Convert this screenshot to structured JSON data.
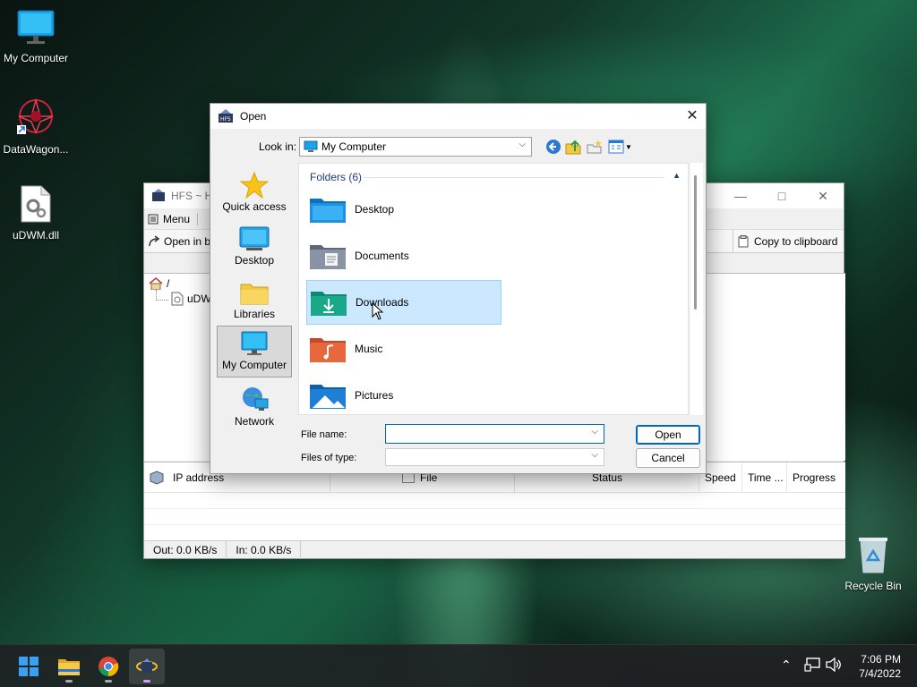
{
  "desktop": {
    "icons": [
      {
        "label": "My Computer",
        "icon": "monitor-icon"
      },
      {
        "label": "DataWagon...",
        "icon": "datawagon-icon"
      },
      {
        "label": "uDWM.dll",
        "icon": "dll-file-icon"
      },
      {
        "label": "Recycle Bin",
        "icon": "recycle-bin-icon"
      }
    ]
  },
  "hfs": {
    "title": "HFS ~ H",
    "menu_label": "Menu",
    "open_in_browser": "Open in b",
    "copy_clipboard": "Copy to clipboard",
    "tree_root": "/",
    "tree_item": "uDW",
    "columns": [
      "IP address",
      "File",
      "Status",
      "Speed",
      "Time ...",
      "Progress"
    ],
    "status_out": "Out: 0.0 KB/s",
    "status_in": "In: 0.0 KB/s"
  },
  "dialog": {
    "title": "Open",
    "look_in_label": "Look in:",
    "look_in_value": "My Computer",
    "places": [
      {
        "label": "Quick access",
        "icon": "star-icon"
      },
      {
        "label": "Desktop",
        "icon": "desktop-icon"
      },
      {
        "label": "Libraries",
        "icon": "libraries-icon"
      },
      {
        "label": "My Computer",
        "icon": "monitor-icon",
        "selected": true
      },
      {
        "label": "Network",
        "icon": "network-icon"
      }
    ],
    "group_header": "Folders (6)",
    "folders": [
      {
        "label": "Desktop",
        "icon": "desktop-folder-icon",
        "color": "#1f8fe0"
      },
      {
        "label": "Documents",
        "icon": "documents-folder-icon",
        "color": "#7f8a99"
      },
      {
        "label": "Downloads",
        "icon": "downloads-folder-icon",
        "color": "#1aa88a",
        "selected": true
      },
      {
        "label": "Music",
        "icon": "music-folder-icon",
        "color": "#e8673c"
      },
      {
        "label": "Pictures",
        "icon": "pictures-folder-icon",
        "color": "#1f7fd4"
      }
    ],
    "file_name_label": "File name:",
    "file_name_value": "",
    "files_of_type_label": "Files of type:",
    "files_of_type_value": "",
    "open_button": "Open",
    "cancel_button": "Cancel"
  },
  "taskbar": {
    "apps": [
      "start-icon",
      "file-explorer-icon",
      "chrome-icon",
      "hfs-icon"
    ],
    "time": "7:06 PM",
    "date": "7/4/2022"
  },
  "colors": {
    "accent": "#0067c0",
    "selection": "#cce8ff",
    "folder_yellow": "#f5c842"
  }
}
